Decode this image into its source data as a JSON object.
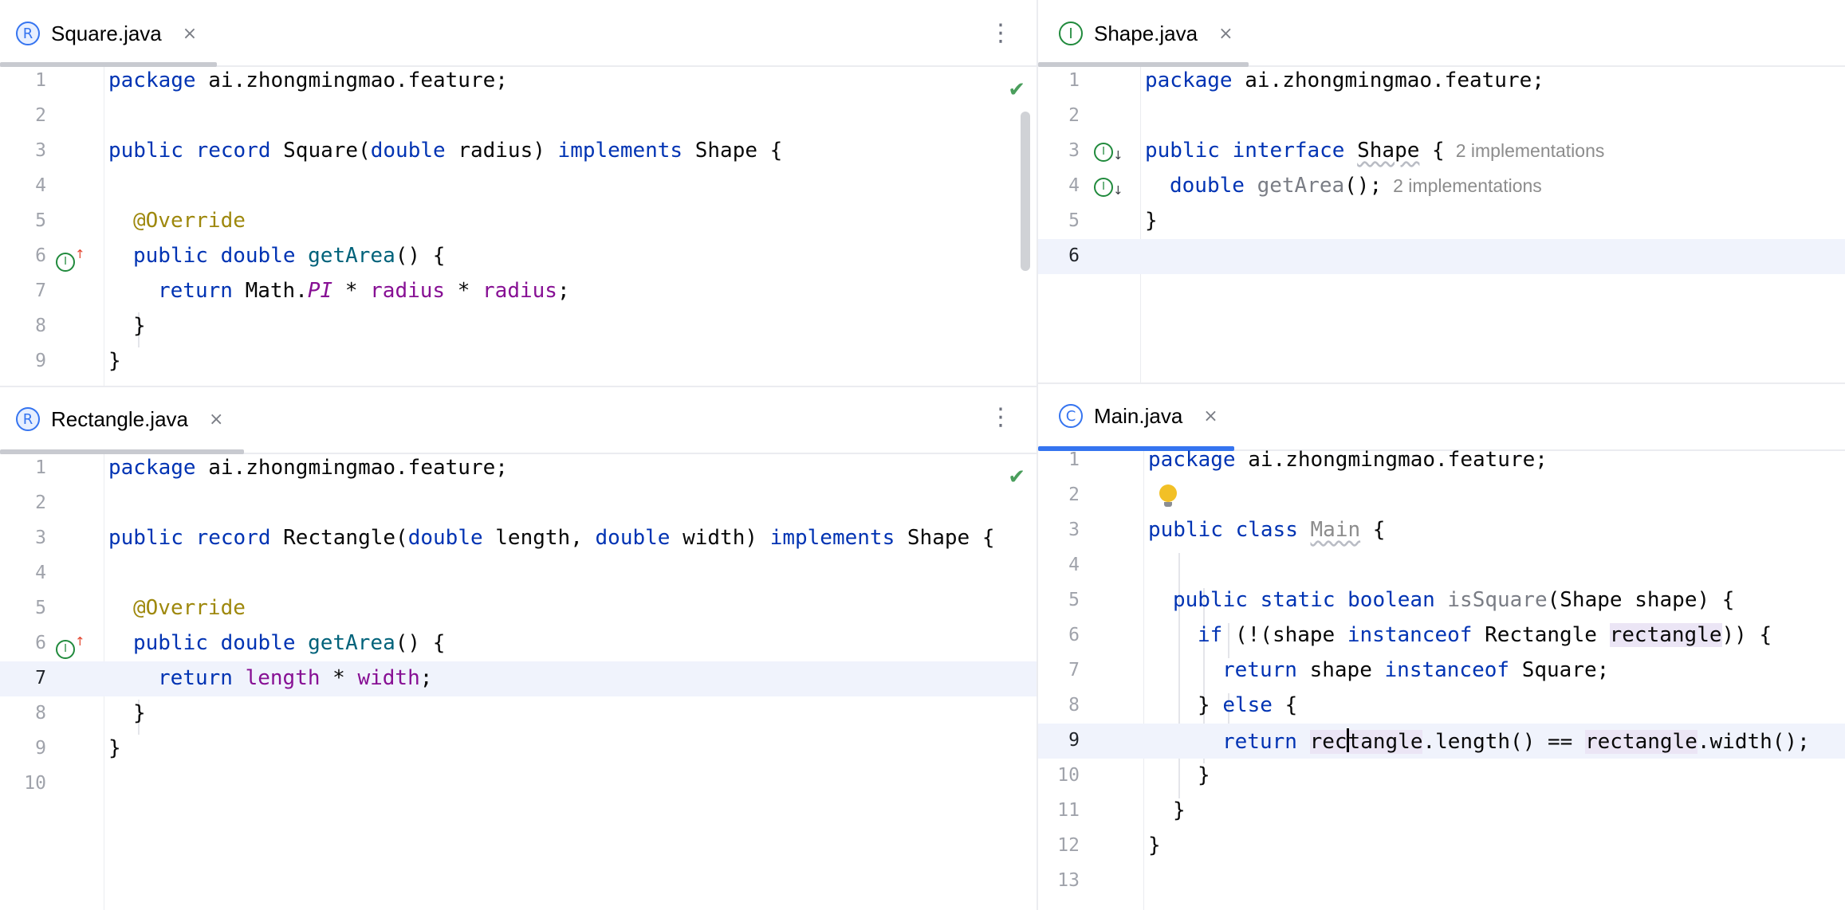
{
  "panes": {
    "square": {
      "tab": {
        "icon_letter": "R",
        "label": "Square.java",
        "close": "×"
      },
      "kebab": "⋮",
      "status_icon": "check-icon",
      "lines": [
        "1",
        "2",
        "3",
        "4",
        "5",
        "6",
        "7",
        "8",
        "9"
      ]
    },
    "shape": {
      "tab": {
        "icon_letter": "I",
        "label": "Shape.java",
        "close": "×"
      },
      "lines": [
        "1",
        "2",
        "3",
        "4",
        "5",
        "6"
      ],
      "hints": {
        "class_impl": "2 implementations",
        "method_impl": "2 implementations"
      }
    },
    "rectangle": {
      "tab": {
        "icon_letter": "R",
        "label": "Rectangle.java",
        "close": "×"
      },
      "kebab": "⋮",
      "status_icon": "check-icon",
      "lines": [
        "1",
        "2",
        "3",
        "4",
        "5",
        "6",
        "7",
        "8",
        "9",
        "10"
      ]
    },
    "main": {
      "tab": {
        "icon_letter": "C",
        "label": "Main.java",
        "close": "×"
      },
      "lines": [
        "1",
        "2",
        "3",
        "4",
        "5",
        "6",
        "7",
        "8",
        "9",
        "10",
        "11",
        "12",
        "13"
      ]
    }
  },
  "code": {
    "package_kw": "package",
    "package_name": " ai.zhongmingmao.feature;",
    "public": "public",
    "record": "record",
    "interface": "interface",
    "class": "class",
    "static": "static",
    "boolean": "boolean",
    "double": "double",
    "implements": "implements",
    "return": "return",
    "if": "if",
    "else": "else",
    "instanceof": "instanceof",
    "override": "@Override",
    "square_name": "Square",
    "square_param": "radius",
    "rect_name": "Rectangle",
    "length": "length",
    "width": "width",
    "shape": "Shape",
    "getArea": "getArea",
    "main": "Main",
    "isSquare": "isSquare",
    "math": "Math.",
    "pi": "PI",
    "rectangle_var": "rectangle",
    "shape_var": "shape"
  },
  "colors": {
    "keyword": "#0033b3",
    "annotation": "#9e880d",
    "method": "#00627a",
    "field": "#871094",
    "active_tab": "#3574f0"
  }
}
